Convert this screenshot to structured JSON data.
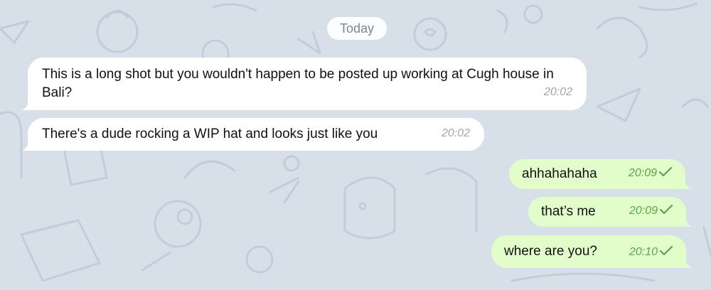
{
  "chat": {
    "date_separator": "Today",
    "messages": [
      {
        "direction": "incoming",
        "text": "This is a long shot but you wouldn't happen to be posted up working at Cugh house in Bali?",
        "time": "20:02"
      },
      {
        "direction": "incoming",
        "text": "There's a dude rocking a WIP hat and looks just like you",
        "time": "20:02"
      },
      {
        "direction": "outgoing",
        "text": "ahhahahaha",
        "time": "20:09",
        "status_icon": "check-icon"
      },
      {
        "direction": "outgoing",
        "text": "that’s me",
        "time": "20:09",
        "status_icon": "check-icon"
      },
      {
        "direction": "outgoing",
        "text": "where are you?",
        "time": "20:10",
        "status_icon": "check-icon"
      }
    ]
  },
  "colors": {
    "background": "#d7dfe9",
    "incoming_bubble": "#ffffff",
    "outgoing_bubble": "#e3fdca",
    "outgoing_time": "#5aa54b",
    "incoming_time": "#a0a7ae"
  }
}
